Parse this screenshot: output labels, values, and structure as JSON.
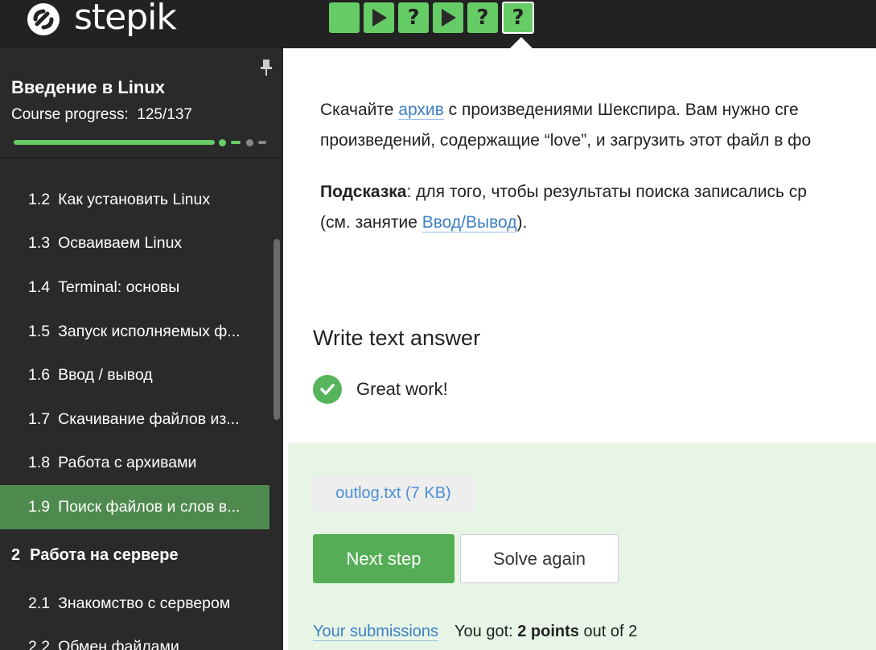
{
  "header": {
    "logo_text": "stepik",
    "steps": [
      {
        "type": "theory",
        "icon": "square-icon",
        "status": "passed"
      },
      {
        "type": "video",
        "icon": "play-icon",
        "status": "passed"
      },
      {
        "type": "quiz",
        "icon": "question-icon",
        "status": "passed"
      },
      {
        "type": "video",
        "icon": "play-icon",
        "status": "passed"
      },
      {
        "type": "quiz",
        "icon": "question-icon",
        "status": "passed"
      },
      {
        "type": "quiz",
        "icon": "question-icon",
        "status": "passed",
        "active": true
      }
    ],
    "question_mark": "?"
  },
  "sidebar": {
    "course_title": "Введение в Linux",
    "progress_label": "Course progress:",
    "progress_value": "125/137",
    "progress_fraction": 0.912,
    "lessons": [
      {
        "num": "1.2",
        "title": "Как установить Linux"
      },
      {
        "num": "1.3",
        "title": "Осваиваем Linux"
      },
      {
        "num": "1.4",
        "title": "Terminal: основы"
      },
      {
        "num": "1.5",
        "title": "Запуск исполняемых ф..."
      },
      {
        "num": "1.6",
        "title": "Ввод / вывод"
      },
      {
        "num": "1.7",
        "title": "Скачивание файлов из..."
      },
      {
        "num": "1.8",
        "title": "Работа с архивами"
      },
      {
        "num": "1.9",
        "title": "Поиск файлов и слов в...",
        "active": true
      }
    ],
    "section": {
      "num": "2",
      "title": "Работа на сервере"
    },
    "section_lessons": [
      {
        "num": "2.1",
        "title": "Знакомство с сервером"
      },
      {
        "num": "2.2",
        "title": "Обмен файлами"
      }
    ]
  },
  "content": {
    "p1_line1_a": "Скачайте ",
    "p1_link": "архив",
    "p1_line1_b": " с произведениями Шекспира. Вам нужно сге",
    "p1_line2": "произведений, содержащие “love”, и загрузить этот файл в фо",
    "p2_bold": "Подсказка",
    "p2_line1": ": для того, чтобы результаты поиска записались ср",
    "p2_line2_a": "(см. занятие ",
    "p2_link": "Ввод/Вывод",
    "p2_line2_b": ")."
  },
  "answer": {
    "title": "Write text answer",
    "feedback": "Great work!",
    "file": "outlog.txt (7 KB)",
    "next_button": "Next step",
    "again_button": "Solve again",
    "submissions_link": "Your submissions",
    "score_prefix": "You got: ",
    "score_points": "2 points",
    "score_suffix": " out of 2"
  },
  "colors": {
    "accent_green": "#66cc66",
    "button_green": "#55ae55",
    "active_lesson": "#4e8a4e",
    "link_blue": "#3d7fc4",
    "panel_bg": "#e6f5e6"
  }
}
